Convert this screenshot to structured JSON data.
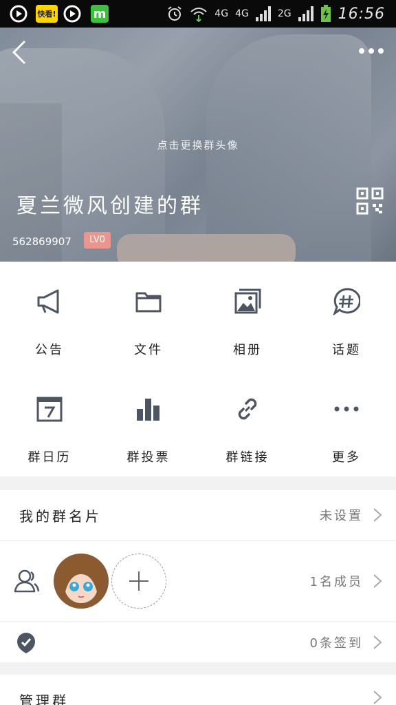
{
  "status_bar": {
    "apps": [
      "video-app-icon",
      "kuaikan-app-icon",
      "video-app-icon",
      "m-app-icon"
    ],
    "kuaikan_label": "快看!",
    "m_label": "m",
    "network_1": "4G",
    "network_2": "4G",
    "network_3": "2G",
    "time": "16:56"
  },
  "header": {
    "change_avatar_hint": "点击更换群头像",
    "group_name": "夏兰微风创建的群",
    "group_id": "562869907",
    "level_badge": "LV0"
  },
  "features": [
    {
      "label": "公告",
      "icon": "megaphone-icon"
    },
    {
      "label": "文件",
      "icon": "folder-icon"
    },
    {
      "label": "相册",
      "icon": "photo-album-icon"
    },
    {
      "label": "话题",
      "icon": "hashtag-chat-icon"
    },
    {
      "label": "群日历",
      "icon": "calendar-icon"
    },
    {
      "label": "群投票",
      "icon": "bar-chart-icon"
    },
    {
      "label": "群链接",
      "icon": "link-icon"
    },
    {
      "label": "更多",
      "icon": "more-dots-icon"
    }
  ],
  "my_card": {
    "title": "我的群名片",
    "value": "未设置"
  },
  "members": {
    "count_text": "1名成员"
  },
  "checkin": {
    "value": "0条签到"
  },
  "manage": {
    "title": "管理群"
  },
  "colors": {
    "icon_gray": "#4d5563",
    "badge": "#e8968f",
    "header_text": "#ffffff"
  }
}
